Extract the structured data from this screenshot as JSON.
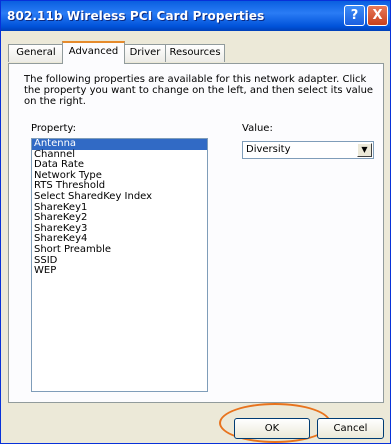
{
  "window": {
    "title": "802.11b Wireless PCI Card Properties",
    "help_glyph": "?",
    "close_glyph": "X"
  },
  "tabs": [
    {
      "label": "General"
    },
    {
      "label": "Advanced",
      "active": true
    },
    {
      "label": "Driver"
    },
    {
      "label": "Resources"
    }
  ],
  "description": "The following properties are available for this network adapter. Click the property you want to change on the left, and then select its value on the right.",
  "property": {
    "label": "Property:",
    "items": [
      "Antenna",
      "Channel",
      "Data Rate",
      "Network Type",
      "RTS Threshold",
      "Select SharedKey Index",
      "ShareKey1",
      "ShareKey2",
      "ShareKey3",
      "ShareKey4",
      "Short Preamble",
      "SSID",
      "WEP"
    ],
    "selected": "Antenna"
  },
  "value": {
    "label": "Value:",
    "selected": "Diversity"
  },
  "buttons": {
    "ok": "OK",
    "cancel": "Cancel"
  },
  "colors": {
    "highlight_ring": "#e8731d",
    "selection": "#316ac5"
  }
}
